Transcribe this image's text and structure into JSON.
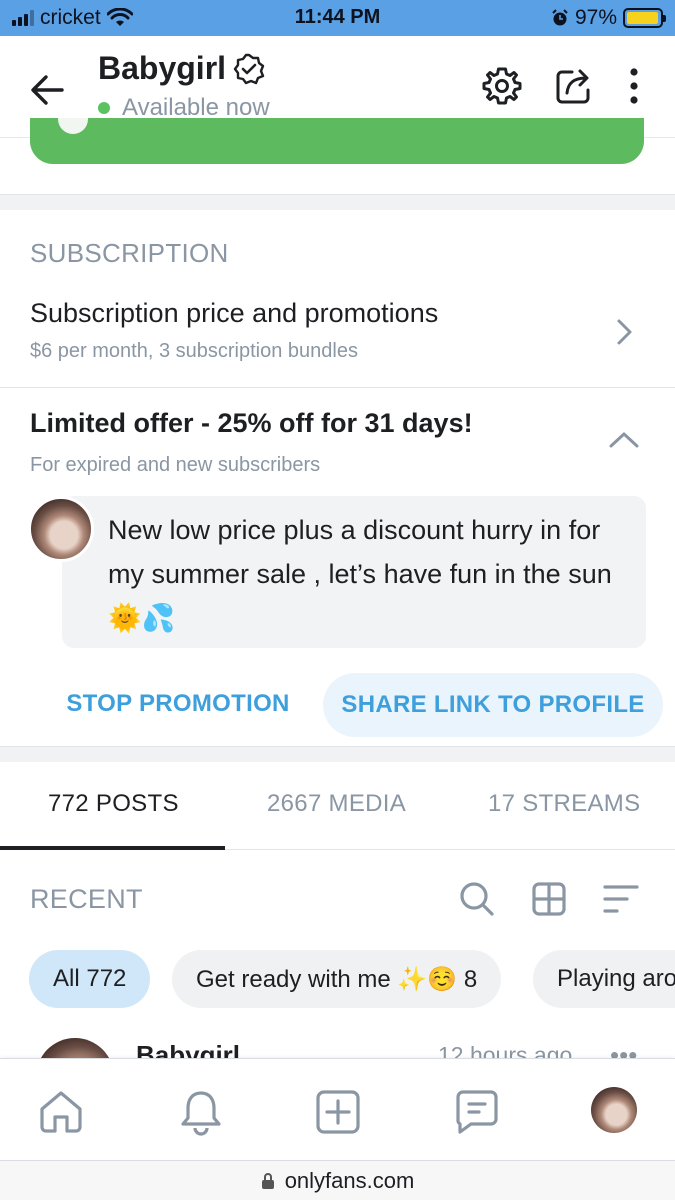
{
  "status_bar": {
    "carrier": "cricket",
    "time": "11:44 PM",
    "battery": "97%",
    "battery_fill": 0.97
  },
  "header": {
    "name": "Babygirl",
    "status": "Available now"
  },
  "subscription": {
    "section_title": "SUBSCRIPTION",
    "row_title": "Subscription price and promotions",
    "row_sub": "$6 per month, 3 subscription bundles"
  },
  "promo": {
    "title": "Limited offer - 25% off for 31 days!",
    "subtitle": "For expired and new subscribers",
    "message": "New low price plus a discount hurry in for my summer sale , let’s have fun in the sun 🌞💦",
    "stop_label": "STOP PROMOTION",
    "share_label": "SHARE LINK TO PROFILE"
  },
  "tabs": [
    {
      "label": "772 POSTS",
      "active": true
    },
    {
      "label": "2667 MEDIA",
      "active": false
    },
    {
      "label": "17 STREAMS",
      "active": false
    }
  ],
  "recent": {
    "title": "RECENT"
  },
  "chips": [
    {
      "label": "All 772",
      "active": true
    },
    {
      "label": "Get ready with me ✨☺️ 8",
      "active": false
    },
    {
      "label": "Playing aro",
      "active": false
    }
  ],
  "post_preview": {
    "name": "Babygirl",
    "time": "12 hours ago"
  },
  "url": "onlyfans.com",
  "icons": [
    "back-arrow-icon",
    "verified-icon",
    "gear-icon",
    "share-icon",
    "more-icon",
    "chevron-right-icon",
    "chevron-up-icon",
    "search-icon",
    "grid-icon",
    "sort-icon",
    "home-icon",
    "bell-icon",
    "plus-square-icon",
    "chat-icon",
    "lock-icon"
  ],
  "colors": {
    "accent": "#3d9fdc",
    "online": "#5ac35f",
    "green_bar": "#5dba5e",
    "status_bar": "#5aa0e4"
  }
}
